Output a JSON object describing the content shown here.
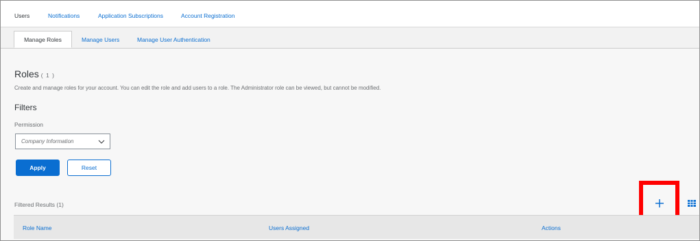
{
  "top_tabs": [
    {
      "label": "Users"
    },
    {
      "label": "Notifications"
    },
    {
      "label": "Application Subscriptions"
    },
    {
      "label": "Account Registration"
    }
  ],
  "sub_tabs": [
    {
      "label": "Manage Roles"
    },
    {
      "label": "Manage Users"
    },
    {
      "label": "Manage User Authentication"
    }
  ],
  "roles": {
    "title": "Roles",
    "count": "( 1 )",
    "description": "Create and manage roles for your account. You can edit the role and add users to a role. The Administrator role can be viewed, but cannot be modified."
  },
  "filters": {
    "heading": "Filters",
    "permission_label": "Permission",
    "permission_value": "Company Information",
    "apply_label": "Apply",
    "reset_label": "Reset"
  },
  "results": {
    "label": "Filtered Results  (1)"
  },
  "table": {
    "columns": [
      "Role Name",
      "Users Assigned",
      "Actions"
    ]
  },
  "colors": {
    "accent": "#0a6ed1",
    "highlight": "#ff0000"
  }
}
